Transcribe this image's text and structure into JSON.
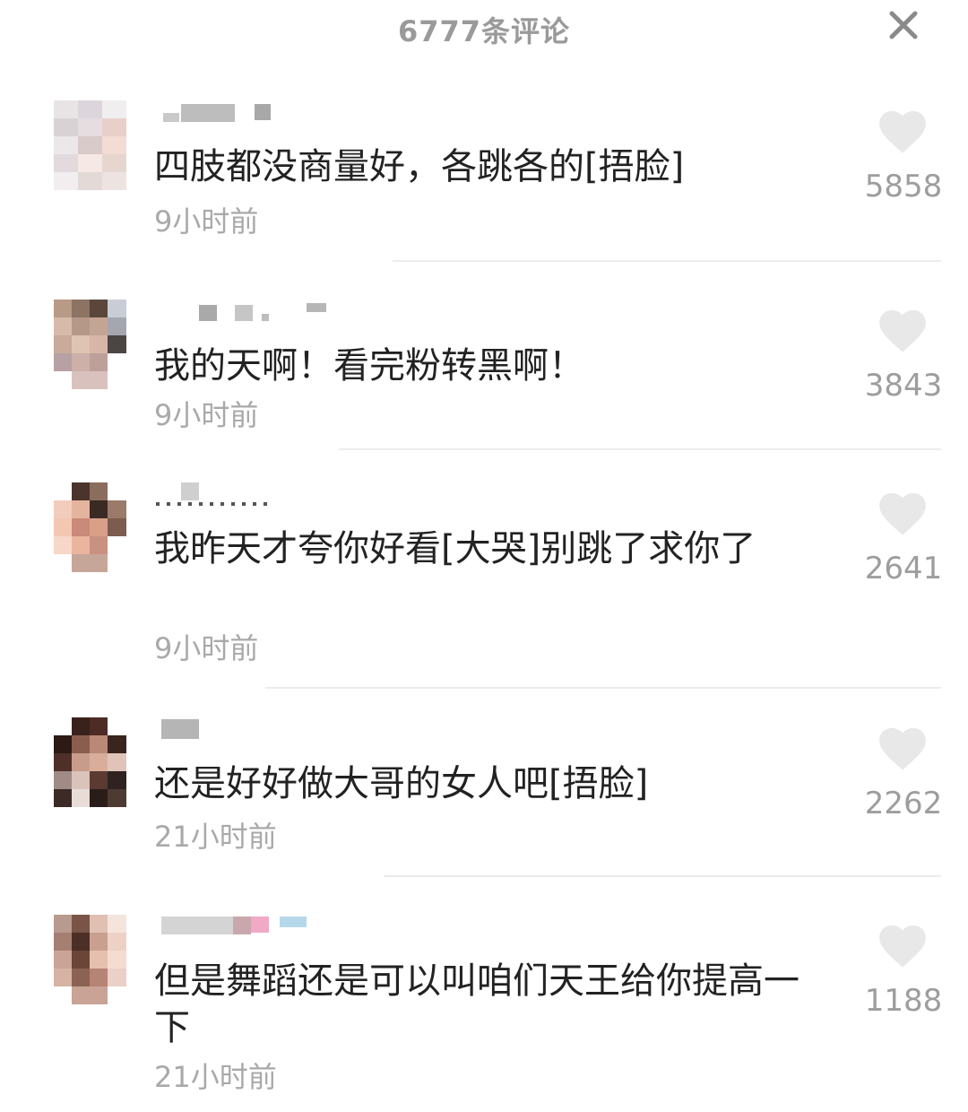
{
  "header": {
    "title": "6777条评论",
    "close_icon": "close-icon"
  },
  "comments": [
    {
      "text": "四肢都没商量好，各跳各的[捂脸]",
      "time": "9小时前",
      "likes": "5858"
    },
    {
      "text": "我的天啊！看完粉转黑啊！",
      "time": "9小时前",
      "likes": "3843"
    },
    {
      "text": "我昨天才夸你好看[大哭]别跳了求你了",
      "time": "9小时前",
      "likes": "2641"
    },
    {
      "text": "还是好好做大哥的女人吧[捂脸]",
      "time": "21小时前",
      "likes": "2262"
    },
    {
      "text": "但是舞蹈还是可以叫咱们天王给你提高一下",
      "time": "21小时前",
      "likes": "1188"
    }
  ],
  "colors": {
    "title": "#9a9a9a",
    "text": "#222222",
    "muted": "#a9a9a9",
    "heart": "#e8e8e8"
  },
  "icons": {
    "like": "heart-icon",
    "avatar": "pixelated-avatar",
    "username": "pixelated-username"
  }
}
